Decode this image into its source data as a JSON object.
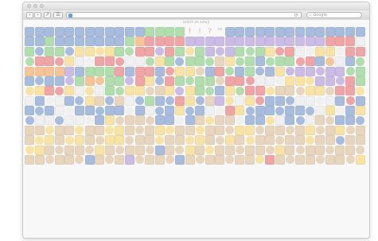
{
  "window": {
    "title": "",
    "search_placeholder": "Google",
    "page_title": "select an emoji",
    "reload_icon": "reload-icon"
  },
  "colors": {
    "key_blue": "#6f8fc6",
    "key_gray": "#a9a9b0",
    "key_purple": "#a98fd6",
    "key_orange": "#ef9f55",
    "key_green": "#7ec77a",
    "key_pink": "#e69bb8",
    "red": "#e46a6a",
    "yellow": "#f4d06b",
    "tan": "#d8ba92",
    "brown": "#b58a62",
    "light": "#e7e7e7",
    "dark": "#7c7c7c"
  },
  "emoji_rows": [
    "BBBBBBBBBBBBGGGG!!?TBBBBBBBBBBBBBBBBB",
    "BBGBBBBBBBGORRRRPPPPPPPPPPPPPPRRR",
    "GBGGBYYYYGGRRPRGYGPPPGGGYRRLLYYLRRO",
    "GRRRYLLRRRLLGYGBGGGTYGGBGGGRRBOLBG",
    "OOOOPBGGGRBRRBRYYTBRGBGBBYPPPPPPGG",
    "BBBBPGOOGGPRYBRGGGGTRRRLLLYYYPPPRG",
    "YYRRYLYLGGYYTTYPYGGBYGRRYTTTYYTRRYB",
    "LBLLBBYTBTLBGBBRYBTPYLYRBBBLLLLBRB",
    "BBBLLBBBBBLBLBBYBBLLRYBBBBBBBLYLBYB",
    "BLLBLLLBYTTTTBBLBTYTTLBBYLBBLTTBBBR",
    "TTYTTYTTYYTTTYYTTYTTTYYTTTTTYTTYTTT",
    "TYYTYYTTYYTTTYTTYYTTYTYTTTTTYTTBTTT",
    "YYTTTTTYTTTTTBTTYTYTTTTTTYTTTTTTTTY",
    "TTTTTTBTTTPTTTTBTTTTTTTYRTTTTTTTTYT"
  ],
  "emoji_count": 476
}
